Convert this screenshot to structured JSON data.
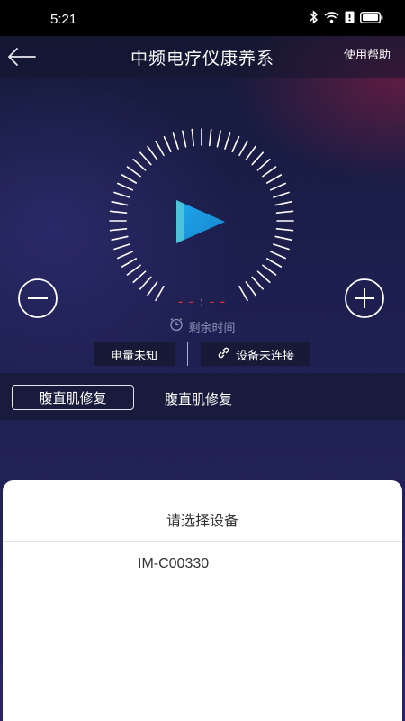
{
  "status_bar": {
    "time": "5:21",
    "icons": [
      "bluetooth-icon",
      "wifi-icon",
      "alert-icon",
      "battery-icon"
    ]
  },
  "header": {
    "back_icon": "arrow-left-icon",
    "title": "中频电疗仪康养系",
    "help_label": "使用帮助"
  },
  "player": {
    "play_icon": "play-icon",
    "minus_icon": "minus-circle-icon",
    "plus_icon": "plus-circle-icon",
    "timer": "--:--",
    "remaining_icon": "clock-icon",
    "remaining_label": "剩余时间"
  },
  "info": {
    "battery_label": "电量未知",
    "link_icon": "link-icon",
    "device_status": "设备未连接"
  },
  "programs": {
    "selected": "腹直肌修复",
    "other": "腹直肌修复"
  },
  "device_sheet": {
    "title": "请选择设备",
    "devices": [
      "IM-C00330"
    ]
  },
  "colors": {
    "accent_play": "#1aa3e8",
    "timer_red": "#e0312e",
    "background": "#1d1f4f",
    "sheet": "#ffffff"
  }
}
